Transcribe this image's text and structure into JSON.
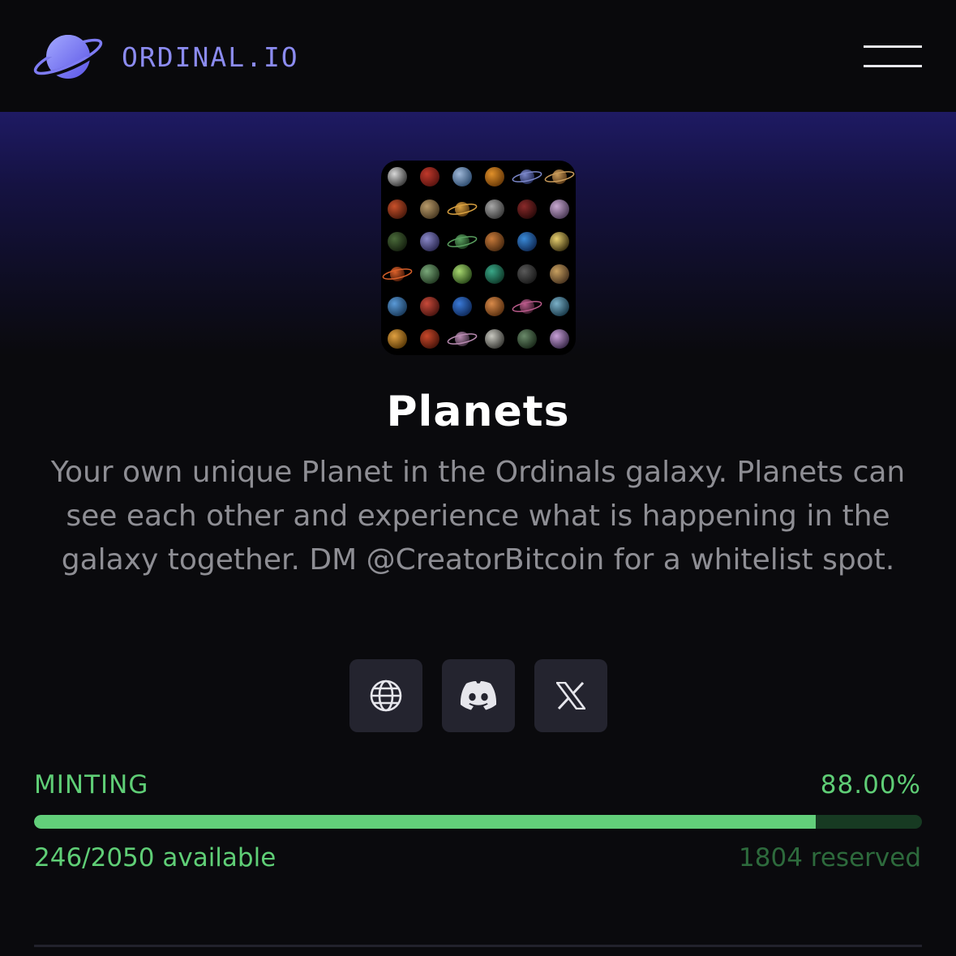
{
  "header": {
    "brand": "ORDINAL.IO",
    "logo_icon": "planet-icon",
    "menu_icon": "hamburger-menu-icon"
  },
  "collection": {
    "name": "Planets",
    "description": "Your own unique Planet in the Ordinals galaxy. Planets can see each other and experience what is happening in the galaxy together. DM @CreatorBitcoin for a whitelist spot.",
    "image_icon": "planets-collection-thumbnail"
  },
  "links": [
    {
      "icon": "globe-icon",
      "kind": "website"
    },
    {
      "icon": "discord-icon",
      "kind": "discord"
    },
    {
      "icon": "x-logo-icon",
      "kind": "x"
    }
  ],
  "mint": {
    "status": "MINTING",
    "percent_label": "88.00%",
    "progress_fraction": 0.88,
    "available_label": "246/2050 available",
    "reserved_label": "1804 reserved"
  },
  "colors": {
    "accent": "#8b8bf0",
    "progress": "#62cf7a",
    "progress_track": "#173a22",
    "status_text": "#5fce76",
    "reserved_text": "#2d6a3c",
    "button_bg": "#24242f"
  }
}
